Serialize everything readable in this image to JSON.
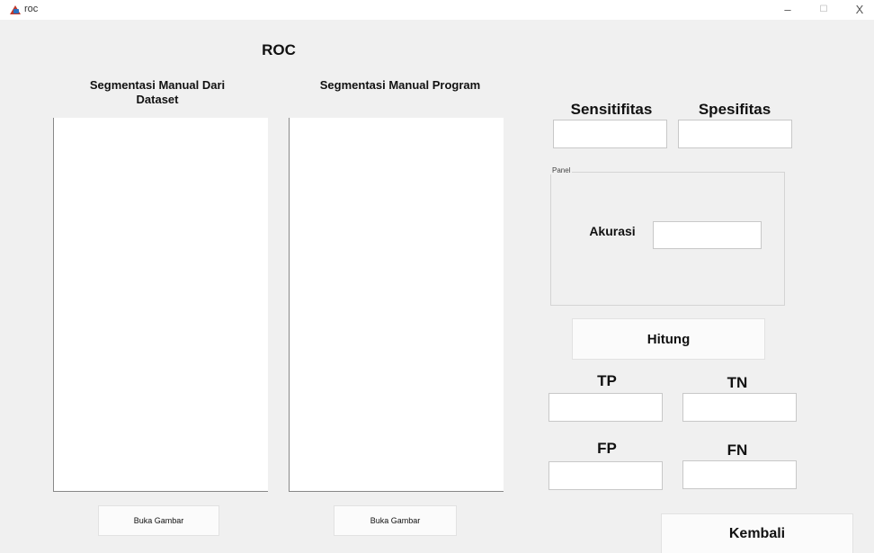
{
  "window": {
    "title": "roc",
    "min_glyph": "–",
    "max_glyph": "☐",
    "close_glyph": "X"
  },
  "figure": {
    "title": "ROC",
    "axes_left_label": "Segmentasi Manual Dari Dataset",
    "axes_right_label": "Segmentasi Manual Program",
    "sens_label": "Sensitifitas",
    "spes_label": "Spesifitas",
    "panel_title": "Panel",
    "akurasi_label": "Akurasi",
    "hitung_label": "Hitung",
    "tp_label": "TP",
    "tn_label": "TN",
    "fp_label": "FP",
    "fn_label": "FN",
    "buka_left_label": "Buka Gambar",
    "buka_right_label": "Buka Gambar",
    "kembali_label": "Kembali",
    "values": {
      "sens": "",
      "spes": "",
      "akurasi": "",
      "tp": "",
      "tn": "",
      "fp": "",
      "fn": ""
    }
  }
}
